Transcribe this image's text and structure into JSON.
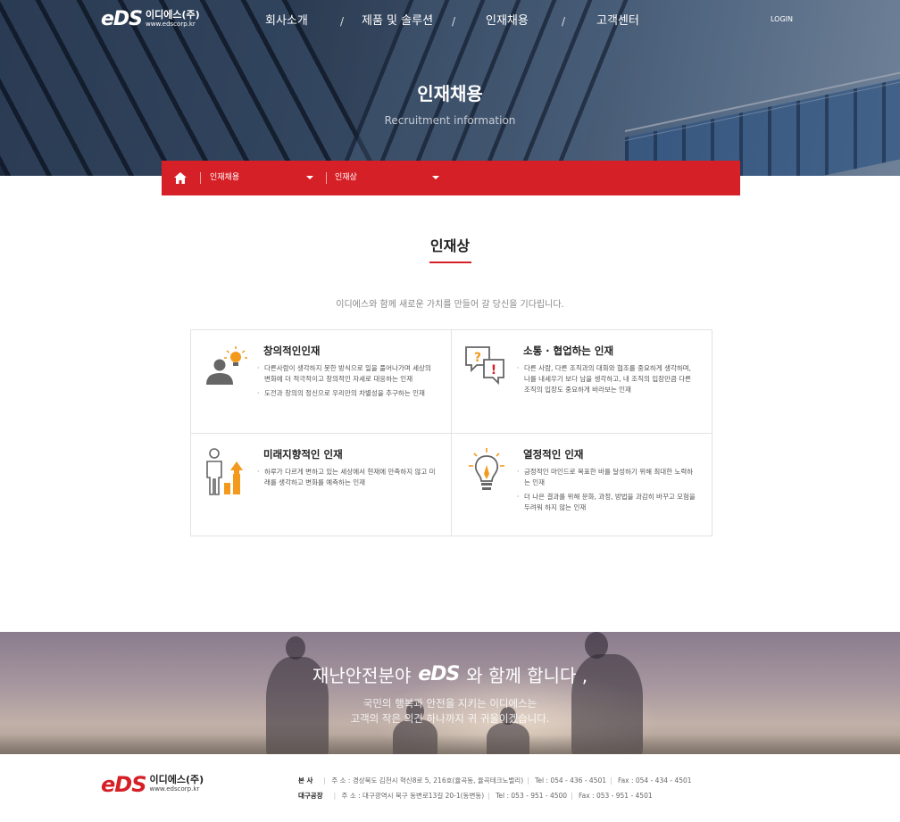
{
  "header": {
    "logo_mark": "eDS",
    "logo_name": "이디에스(주)",
    "logo_url": "www.edscorp.kr",
    "menu": [
      "회사소개",
      "제품 및 솔루션",
      "인재채용",
      "고객센터"
    ],
    "separator": "/",
    "login": "LOGIN"
  },
  "hero": {
    "title": "인재채용",
    "subtitle": "Recruitment information"
  },
  "breadcrumb": {
    "item1": "인재채용",
    "item2": "인재상"
  },
  "section": {
    "title": "인재상",
    "description": "이디에스와 함께 새로운 가치를 만들어 갈 당신을 기다립니다."
  },
  "cards": [
    {
      "icon": "idea-person-icon",
      "title": "창의적인인재",
      "items": [
        "다른사람이 생각하지 못한 방식으로 일을 풀어나가며 세상의 변화에 더 적극적이고 창의적인 자세로 대응하는 인재",
        "도전과 창의의 정신으로 우리만의 차별성을 추구하는 인재"
      ]
    },
    {
      "icon": "speech-bubbles-icon",
      "title": "소통 · 협업하는 인재",
      "items": [
        "다른 사람, 다른 조직과의 대화와 협조를 중요하게 생각하며, 나를 내세우기 보다 남을 생각하고, 내 조직의 입장만큼 다른 조직의 입장도 중요하게 바라보는 인재"
      ]
    },
    {
      "icon": "growth-person-icon",
      "title": "미래지향적인 인재",
      "items": [
        "하루가 다르게 변하고 있는 세상에서 현재에 만족하지 않고 미래를 생각하고 변화를 예측하는 인재"
      ]
    },
    {
      "icon": "lightbulb-icon",
      "title": "열정적인 인재",
      "items": [
        "긍정적인 마인드로 목표한 바를 달성하기 위해 최대한 노력하는 인재",
        "더 나은 결과를 위해 문화, 과정, 방법을 과감히 바꾸고 모험을 두려워 하지 않는 인재"
      ]
    }
  ],
  "banner": {
    "title_before": "재난안전분야",
    "title_logo": "eDS",
    "title_after": "와 함께 합니다 ,",
    "line1": "국민의 행복과 안전을 지키는 이디에스는",
    "line2": "고객의 작은 의견 하나까지 귀 귀울이겠습니다."
  },
  "footer": {
    "logo_mark": "eDS",
    "logo_name": "이디에스(주)",
    "logo_url": "www.edscorp.kr",
    "hq_label": "본 사",
    "hq_address": "주 소 : 경상북도 김천시 혁신8로 5, 216호(율곡동, 율곡테크노밸리)",
    "hq_tel": "Tel : 054 - 436 - 4501",
    "hq_fax": "Fax : 054 - 434 - 4501",
    "daegu_label": "대구공장",
    "daegu_address": "주 소 : 대구광역시 북구 동변로13길 20-1(동변동)",
    "daegu_tel": "Tel : 053 - 951 - 4500",
    "daegu_fax": "Fax : 053 - 951 - 4501"
  },
  "colors": {
    "accent": "#d62027",
    "icon_orange": "#f39a1e",
    "icon_gray": "#666666"
  }
}
